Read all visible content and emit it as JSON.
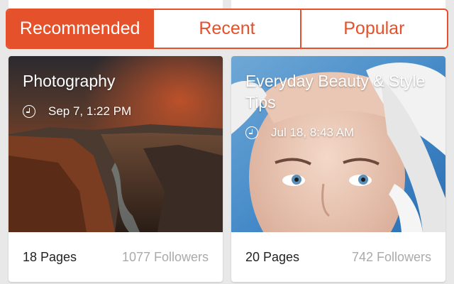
{
  "tabs": [
    {
      "label": "Recommended",
      "active": true
    },
    {
      "label": "Recent",
      "active": false
    },
    {
      "label": "Popular",
      "active": false
    }
  ],
  "colors": {
    "accent": "#e4512b"
  },
  "cards": [
    {
      "title": "Photography",
      "time": "Sep 7, 1:22 PM",
      "pages": "18 Pages",
      "followers": "1077 Followers",
      "image": "canyon-landscape"
    },
    {
      "title": "Everyday Beauty & Style Tips",
      "time": "Jul 18, 8:43 AM",
      "pages": "20 Pages",
      "followers": "742 Followers",
      "image": "woman-face-gloved-hands"
    }
  ]
}
